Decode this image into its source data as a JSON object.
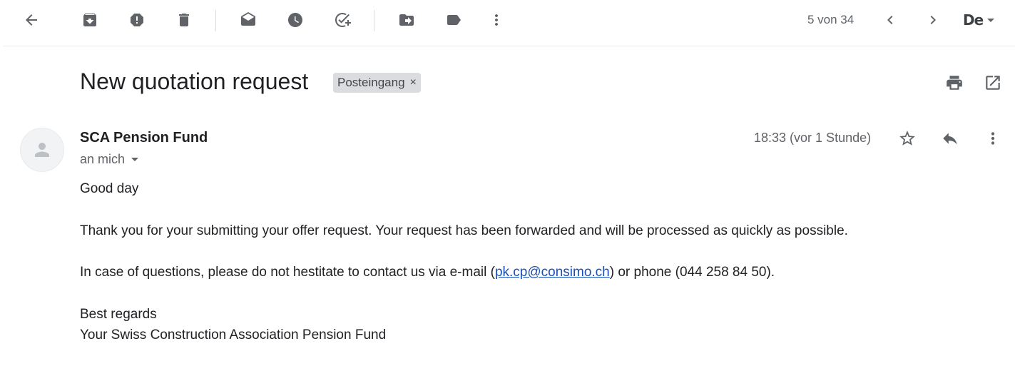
{
  "toolbar": {
    "icons": [
      "back-arrow-icon",
      "archive-icon",
      "report-spam-icon",
      "delete-icon",
      "mark-unread-icon",
      "snooze-icon",
      "add-task-icon",
      "move-to-icon",
      "label-icon",
      "more-vert-icon"
    ],
    "pager": "5 von 34",
    "language": "De"
  },
  "subject": {
    "title": "New quotation request",
    "label": "Posteingang",
    "label_remove": "×"
  },
  "sender": {
    "name": "SCA Pension Fund",
    "recipient": "an mich",
    "timestamp": "18:33 (vor 1 Stunde)"
  },
  "body": {
    "greeting": "Good day",
    "paragraph1": "Thank you for your submitting your offer request. Your request has been forwarded and will be processed as quickly as possible.",
    "paragraph2_prefix": "In case of questions, please do not hestitate to contact us via e-mail (",
    "email": "pk.cp@consimo.ch",
    "paragraph2_suffix": ") or phone (044 258 84 50).",
    "closing1": "Best regards",
    "closing2": "Your Swiss Construction Association Pension Fund"
  },
  "colors": {
    "icon": "#5f6368",
    "link": "#1a4fb3",
    "chip_bg": "#dadce0"
  }
}
